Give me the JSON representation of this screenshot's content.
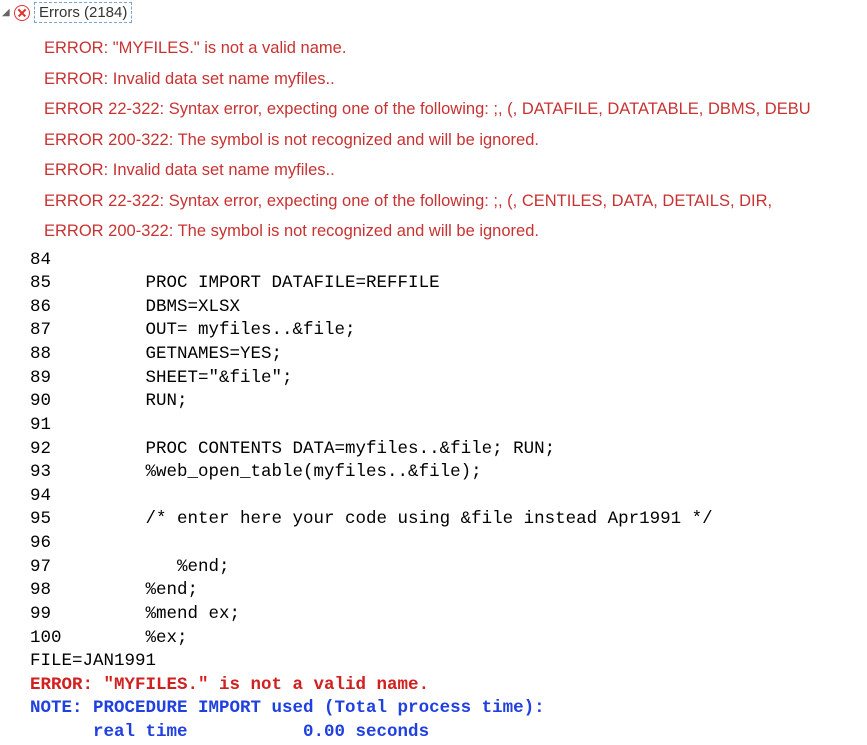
{
  "header": {
    "label": "Errors (2184)"
  },
  "errors": [
    "ERROR: \"MYFILES.\" is not a valid name.",
    "ERROR: Invalid data set name myfiles..",
    "ERROR 22-322: Syntax error, expecting one of the following: ;, (, DATAFILE, DATATABLE, DBMS, DEBU",
    "ERROR 200-322: The symbol is not recognized and will be ignored.",
    "ERROR: Invalid data set name myfiles..",
    "ERROR 22-322: Syntax error, expecting one of the following: ;, (, CENTILES, DATA, DETAILS, DIR,",
    "ERROR 200-322: The symbol is not recognized and will be ignored."
  ],
  "log": [
    {
      "type": "plain",
      "text": "84"
    },
    {
      "type": "plain",
      "text": "85         PROC IMPORT DATAFILE=REFFILE"
    },
    {
      "type": "plain",
      "text": "86         DBMS=XLSX"
    },
    {
      "type": "plain",
      "text": "87         OUT= myfiles..&file;"
    },
    {
      "type": "plain",
      "text": "88         GETNAMES=YES;"
    },
    {
      "type": "plain",
      "text": "89         SHEET=\"&file\";"
    },
    {
      "type": "plain",
      "text": "90         RUN;"
    },
    {
      "type": "plain",
      "text": "91"
    },
    {
      "type": "plain",
      "text": "92         PROC CONTENTS DATA=myfiles..&file; RUN;"
    },
    {
      "type": "plain",
      "text": "93         %web_open_table(myfiles..&file);"
    },
    {
      "type": "plain",
      "text": "94"
    },
    {
      "type": "plain",
      "text": "95         /* enter here your code using &file instead Apr1991 */"
    },
    {
      "type": "plain",
      "text": "96"
    },
    {
      "type": "plain",
      "text": "97            %end;"
    },
    {
      "type": "plain",
      "text": "98         %end;"
    },
    {
      "type": "plain",
      "text": "99         %mend ex;"
    },
    {
      "type": "plain",
      "text": "100        %ex;"
    },
    {
      "type": "plain",
      "text": "FILE=JAN1991"
    },
    {
      "type": "error",
      "text": "ERROR: \"MYFILES.\" is not a valid name."
    },
    {
      "type": "note",
      "text": "NOTE: PROCEDURE IMPORT used (Total process time):"
    },
    {
      "type": "note",
      "text": "      real time           0.00 seconds"
    }
  ]
}
